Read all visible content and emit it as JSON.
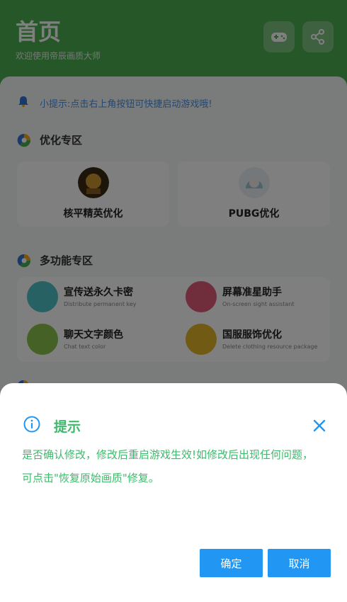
{
  "header": {
    "title": "首页",
    "subtitle": "欢迎使用帝辰画质大师"
  },
  "tip": {
    "text": "小提示:点击右上角按钮可快捷启动游戏哦!"
  },
  "optimize_section": {
    "title": "优化专区",
    "games": [
      {
        "name": "核平精英优化"
      },
      {
        "name": "PUBG优化"
      }
    ]
  },
  "multi_section": {
    "title": "多功能专区",
    "features": [
      {
        "name": "宣传送永久卡密",
        "desc": "Distribute permanent key",
        "color": "#4fc3c9",
        "icon": "camera-icon"
      },
      {
        "name": "屏幕准星助手",
        "desc": "On-screen sight assistant",
        "color": "#e05a78",
        "icon": "crosshair-icon"
      },
      {
        "name": "聊天文字颜色",
        "desc": "Chat text color",
        "color": "#8bc34a",
        "icon": "palette-icon"
      },
      {
        "name": "国服服饰优化",
        "desc": "Delete clothing resource package",
        "color": "#e0b428",
        "icon": "shirt-icon"
      }
    ]
  },
  "dialog": {
    "title": "提示",
    "message": "是否确认修改，修改后重启游戏生效!如修改后出现任何问题，可点击\"恢复原始画质\"修复。",
    "confirm_label": "确定",
    "cancel_label": "取消"
  },
  "colors": {
    "header_green": "#4caf50",
    "dialog_green": "#3dba6c",
    "button_blue": "#2196f3"
  }
}
